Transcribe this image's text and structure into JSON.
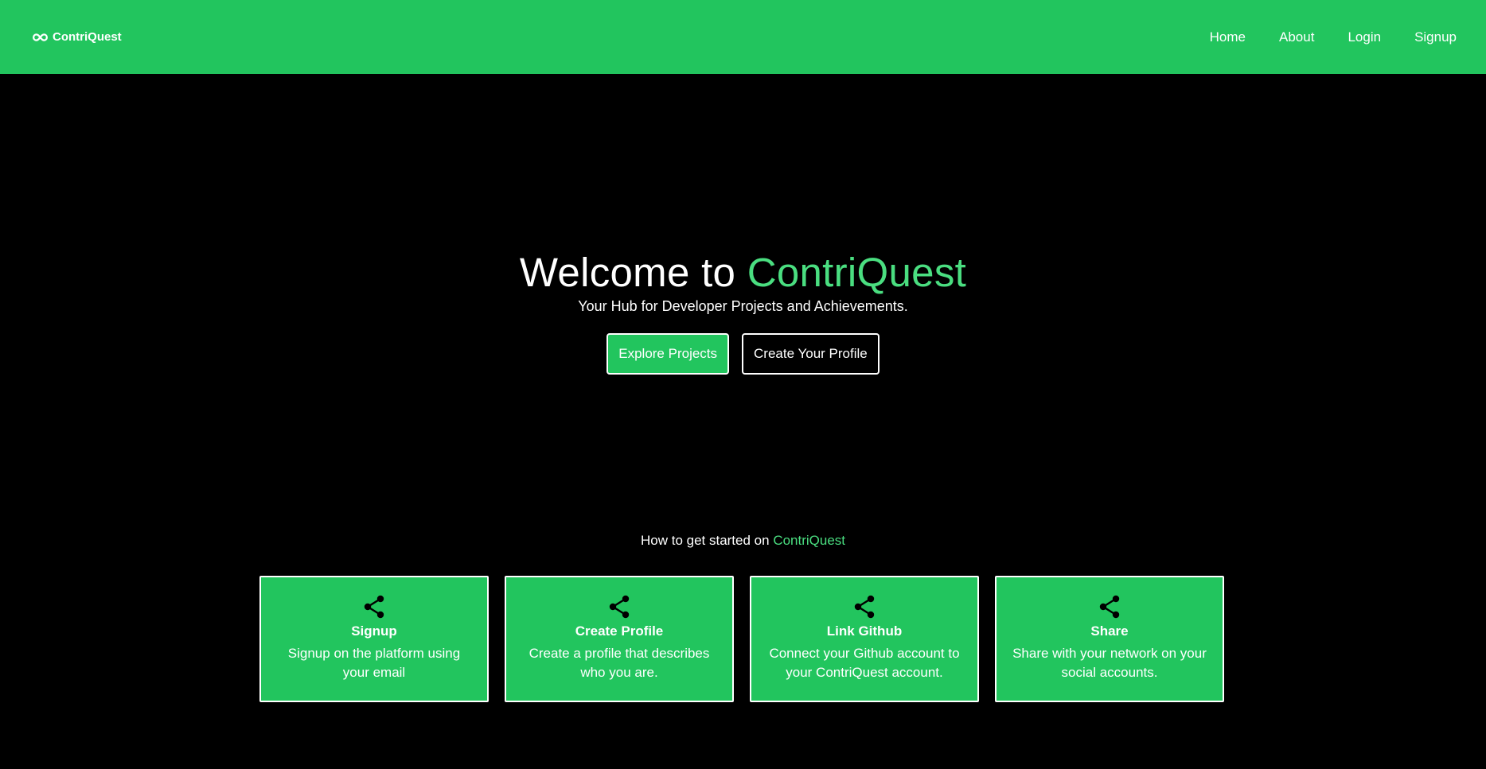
{
  "navbar": {
    "brand": "ContriQuest",
    "brand_icon": "infinity-icon",
    "links": [
      "Home",
      "About",
      "Login",
      "Signup"
    ]
  },
  "hero": {
    "title_prefix": "Welcome to ",
    "title_highlight": "ContriQuest",
    "subtitle": "Your Hub for Developer Projects and Achievements.",
    "primary_button": "Explore Projects",
    "secondary_button": "Create Your Profile"
  },
  "steps": {
    "heading_prefix": "How to get started on ",
    "heading_highlight": "ContriQuest",
    "cards": [
      {
        "icon": "share-icon",
        "title": "Signup",
        "description": "Signup on the platform using your email"
      },
      {
        "icon": "share-icon",
        "title": "Create Profile",
        "description": "Create a profile that describes who you are."
      },
      {
        "icon": "share-icon",
        "title": "Link Github",
        "description": "Connect your Github account to your ContriQuest account."
      },
      {
        "icon": "share-icon",
        "title": "Share",
        "description": "Share with your network on your social accounts."
      }
    ]
  },
  "colors": {
    "primary": "#22c55e",
    "accent_text": "#4ade80",
    "background": "#000000",
    "text": "#ffffff"
  }
}
